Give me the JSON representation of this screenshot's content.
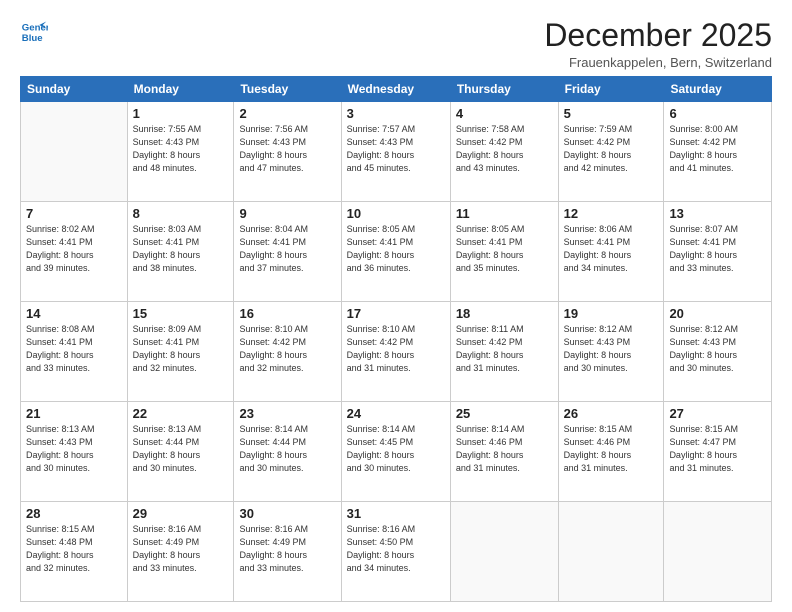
{
  "header": {
    "logo_line1": "General",
    "logo_line2": "Blue",
    "month": "December 2025",
    "location": "Frauenkappelen, Bern, Switzerland"
  },
  "days_of_week": [
    "Sunday",
    "Monday",
    "Tuesday",
    "Wednesday",
    "Thursday",
    "Friday",
    "Saturday"
  ],
  "weeks": [
    [
      {
        "day": "",
        "info": ""
      },
      {
        "day": "1",
        "info": "Sunrise: 7:55 AM\nSunset: 4:43 PM\nDaylight: 8 hours\nand 48 minutes."
      },
      {
        "day": "2",
        "info": "Sunrise: 7:56 AM\nSunset: 4:43 PM\nDaylight: 8 hours\nand 47 minutes."
      },
      {
        "day": "3",
        "info": "Sunrise: 7:57 AM\nSunset: 4:43 PM\nDaylight: 8 hours\nand 45 minutes."
      },
      {
        "day": "4",
        "info": "Sunrise: 7:58 AM\nSunset: 4:42 PM\nDaylight: 8 hours\nand 43 minutes."
      },
      {
        "day": "5",
        "info": "Sunrise: 7:59 AM\nSunset: 4:42 PM\nDaylight: 8 hours\nand 42 minutes."
      },
      {
        "day": "6",
        "info": "Sunrise: 8:00 AM\nSunset: 4:42 PM\nDaylight: 8 hours\nand 41 minutes."
      }
    ],
    [
      {
        "day": "7",
        "info": "Sunrise: 8:02 AM\nSunset: 4:41 PM\nDaylight: 8 hours\nand 39 minutes."
      },
      {
        "day": "8",
        "info": "Sunrise: 8:03 AM\nSunset: 4:41 PM\nDaylight: 8 hours\nand 38 minutes."
      },
      {
        "day": "9",
        "info": "Sunrise: 8:04 AM\nSunset: 4:41 PM\nDaylight: 8 hours\nand 37 minutes."
      },
      {
        "day": "10",
        "info": "Sunrise: 8:05 AM\nSunset: 4:41 PM\nDaylight: 8 hours\nand 36 minutes."
      },
      {
        "day": "11",
        "info": "Sunrise: 8:05 AM\nSunset: 4:41 PM\nDaylight: 8 hours\nand 35 minutes."
      },
      {
        "day": "12",
        "info": "Sunrise: 8:06 AM\nSunset: 4:41 PM\nDaylight: 8 hours\nand 34 minutes."
      },
      {
        "day": "13",
        "info": "Sunrise: 8:07 AM\nSunset: 4:41 PM\nDaylight: 8 hours\nand 33 minutes."
      }
    ],
    [
      {
        "day": "14",
        "info": "Sunrise: 8:08 AM\nSunset: 4:41 PM\nDaylight: 8 hours\nand 33 minutes."
      },
      {
        "day": "15",
        "info": "Sunrise: 8:09 AM\nSunset: 4:41 PM\nDaylight: 8 hours\nand 32 minutes."
      },
      {
        "day": "16",
        "info": "Sunrise: 8:10 AM\nSunset: 4:42 PM\nDaylight: 8 hours\nand 32 minutes."
      },
      {
        "day": "17",
        "info": "Sunrise: 8:10 AM\nSunset: 4:42 PM\nDaylight: 8 hours\nand 31 minutes."
      },
      {
        "day": "18",
        "info": "Sunrise: 8:11 AM\nSunset: 4:42 PM\nDaylight: 8 hours\nand 31 minutes."
      },
      {
        "day": "19",
        "info": "Sunrise: 8:12 AM\nSunset: 4:43 PM\nDaylight: 8 hours\nand 30 minutes."
      },
      {
        "day": "20",
        "info": "Sunrise: 8:12 AM\nSunset: 4:43 PM\nDaylight: 8 hours\nand 30 minutes."
      }
    ],
    [
      {
        "day": "21",
        "info": "Sunrise: 8:13 AM\nSunset: 4:43 PM\nDaylight: 8 hours\nand 30 minutes."
      },
      {
        "day": "22",
        "info": "Sunrise: 8:13 AM\nSunset: 4:44 PM\nDaylight: 8 hours\nand 30 minutes."
      },
      {
        "day": "23",
        "info": "Sunrise: 8:14 AM\nSunset: 4:44 PM\nDaylight: 8 hours\nand 30 minutes."
      },
      {
        "day": "24",
        "info": "Sunrise: 8:14 AM\nSunset: 4:45 PM\nDaylight: 8 hours\nand 30 minutes."
      },
      {
        "day": "25",
        "info": "Sunrise: 8:14 AM\nSunset: 4:46 PM\nDaylight: 8 hours\nand 31 minutes."
      },
      {
        "day": "26",
        "info": "Sunrise: 8:15 AM\nSunset: 4:46 PM\nDaylight: 8 hours\nand 31 minutes."
      },
      {
        "day": "27",
        "info": "Sunrise: 8:15 AM\nSunset: 4:47 PM\nDaylight: 8 hours\nand 31 minutes."
      }
    ],
    [
      {
        "day": "28",
        "info": "Sunrise: 8:15 AM\nSunset: 4:48 PM\nDaylight: 8 hours\nand 32 minutes."
      },
      {
        "day": "29",
        "info": "Sunrise: 8:16 AM\nSunset: 4:49 PM\nDaylight: 8 hours\nand 33 minutes."
      },
      {
        "day": "30",
        "info": "Sunrise: 8:16 AM\nSunset: 4:49 PM\nDaylight: 8 hours\nand 33 minutes."
      },
      {
        "day": "31",
        "info": "Sunrise: 8:16 AM\nSunset: 4:50 PM\nDaylight: 8 hours\nand 34 minutes."
      },
      {
        "day": "",
        "info": ""
      },
      {
        "day": "",
        "info": ""
      },
      {
        "day": "",
        "info": ""
      }
    ]
  ]
}
